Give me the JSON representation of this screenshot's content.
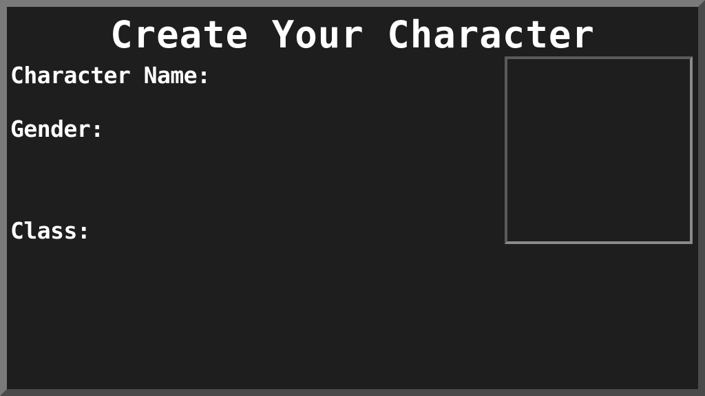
{
  "screen": {
    "title": "Create Your Character",
    "fields": {
      "name_label": "Character Name:",
      "gender_label": "Gender:",
      "class_label": "Class:"
    }
  },
  "colors": {
    "background": "#1e1e1e",
    "frame_light": "#7a7a7a",
    "frame_dark": "#4a4a4a",
    "text": "#ffffff"
  }
}
